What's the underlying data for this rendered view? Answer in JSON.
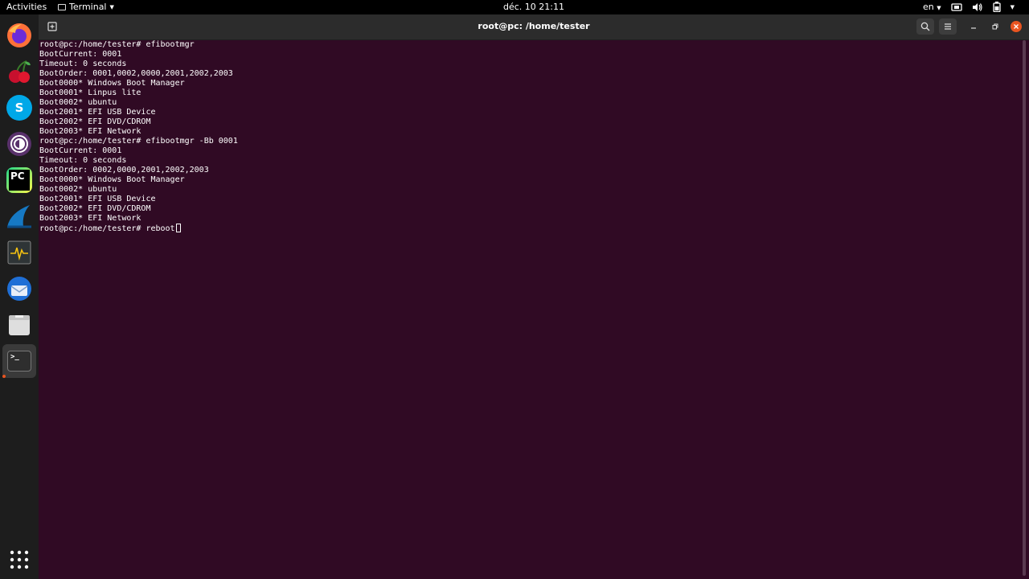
{
  "topbar": {
    "activities": "Activities",
    "app_name": "Terminal",
    "clock": "déc. 10  21:11",
    "language": "en"
  },
  "dock": {
    "apps": [
      {
        "name": "firefox",
        "icon": "firefox-icon"
      },
      {
        "name": "cherrytree",
        "icon": "cherry-icon"
      },
      {
        "name": "skype",
        "icon": "skype-icon",
        "glyph": "S"
      },
      {
        "name": "tor-browser",
        "icon": "tor-icon"
      },
      {
        "name": "pycharm",
        "icon": "pycharm-icon",
        "glyph": "PC"
      },
      {
        "name": "wireshark",
        "icon": "wireshark-icon"
      },
      {
        "name": "system-monitor",
        "icon": "system-monitor-icon"
      },
      {
        "name": "thunderbird",
        "icon": "thunderbird-icon"
      },
      {
        "name": "files",
        "icon": "folder-icon"
      },
      {
        "name": "terminal",
        "icon": "terminal-icon",
        "glyph": ">_"
      }
    ],
    "show_apps_icon": "grid-icon"
  },
  "window": {
    "title": "root@pc: /home/tester"
  },
  "terminal": {
    "lines": [
      "root@pc:/home/tester# efibootmgr",
      "BootCurrent: 0001",
      "Timeout: 0 seconds",
      "BootOrder: 0001,0002,0000,2001,2002,2003",
      "Boot0000* Windows Boot Manager",
      "Boot0001* Linpus lite",
      "Boot0002* ubuntu",
      "Boot2001* EFI USB Device",
      "Boot2002* EFI DVD/CDROM",
      "Boot2003* EFI Network",
      "root@pc:/home/tester# efibootmgr -Bb 0001",
      "BootCurrent: 0001",
      "Timeout: 0 seconds",
      "BootOrder: 0002,0000,2001,2002,2003",
      "Boot0000* Windows Boot Manager",
      "Boot0002* ubuntu",
      "Boot2001* EFI USB Device",
      "Boot2002* EFI DVD/CDROM",
      "Boot2003* EFI Network"
    ],
    "current_prompt": "root@pc:/home/tester# reboot"
  }
}
